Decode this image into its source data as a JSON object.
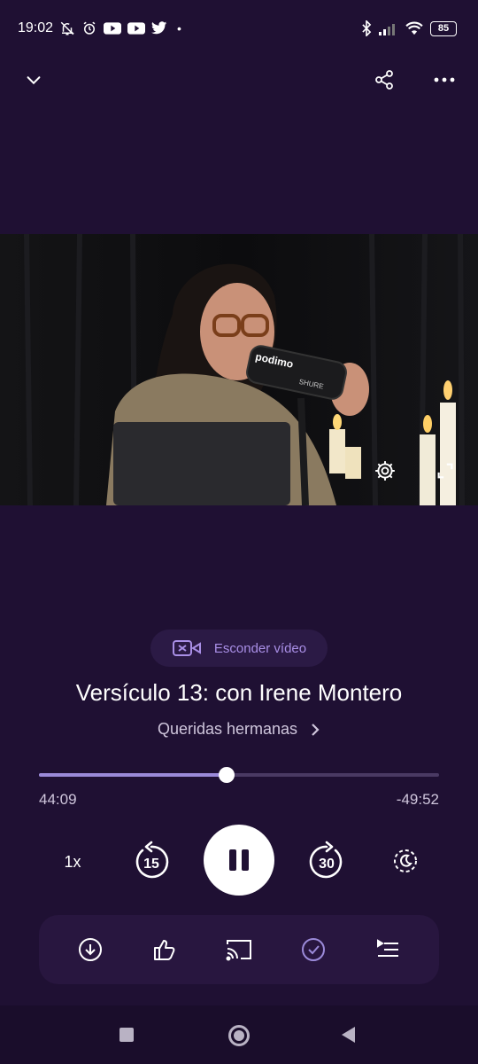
{
  "status_bar": {
    "time": "19:02",
    "battery": "85",
    "left_icons": [
      "mute-icon",
      "alarm-icon",
      "youtube-icon",
      "youtube-icon",
      "twitter-icon"
    ],
    "right_icons": [
      "bluetooth-icon",
      "signal-icon",
      "wifi-icon"
    ]
  },
  "top_nav": {
    "collapse_icon": "chevron-down-icon",
    "share_icon": "share-icon",
    "more_icon": "more-icon"
  },
  "video": {
    "mic_brand": "podimo",
    "mic_model": "SHURE",
    "settings_icon": "gear-icon",
    "expand_icon": "expand-icon"
  },
  "hide_video": {
    "label": "Esconder vídeo"
  },
  "episode": {
    "title": "Versículo 13: con Irene Montero",
    "show": "Queridas hermanas",
    "progress": 0.47
  },
  "time": {
    "elapsed": "44:09",
    "remaining": "-49:52"
  },
  "controls": {
    "speed": "1x",
    "skip_back": "15",
    "skip_forward": "30"
  },
  "colors": {
    "background": "#1f1033",
    "accent": "#9b8ad9",
    "pill_text": "#a98fe6"
  }
}
